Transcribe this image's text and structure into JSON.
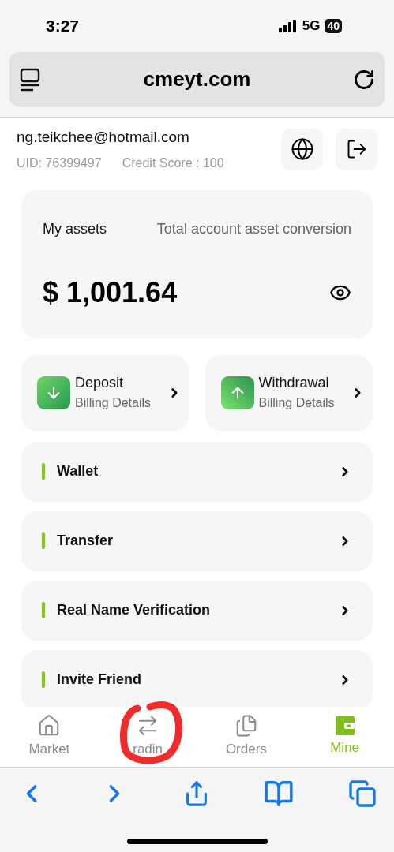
{
  "status_bar": {
    "time": "3:27",
    "network": "5G",
    "battery": "40"
  },
  "browser": {
    "url": "cmeyt.com"
  },
  "profile": {
    "email": "ng.teikchee@hotmail.com",
    "uid": "UID: 76399497",
    "credit_score": "Credit Score : 100"
  },
  "assets": {
    "title": "My assets",
    "subtitle": "Total account asset conversion",
    "amount": "$ 1,001.64"
  },
  "actions": [
    {
      "kind": "deposit",
      "title": "Deposit",
      "subtitle": "Billing Details"
    },
    {
      "kind": "withdrawal",
      "title": "Withdrawal",
      "subtitle": "Billing Details"
    }
  ],
  "menu": [
    {
      "label": "Wallet"
    },
    {
      "label": "Transfer"
    },
    {
      "label": "Real Name Verification"
    },
    {
      "label": "Invite Friend"
    }
  ],
  "tabs": [
    {
      "kind": "market",
      "label": "Market",
      "selected": false
    },
    {
      "kind": "trading",
      "label": "radin",
      "selected": false
    },
    {
      "kind": "orders",
      "label": "Orders",
      "selected": false
    },
    {
      "kind": "mine",
      "label": "Mine",
      "selected": true
    }
  ]
}
